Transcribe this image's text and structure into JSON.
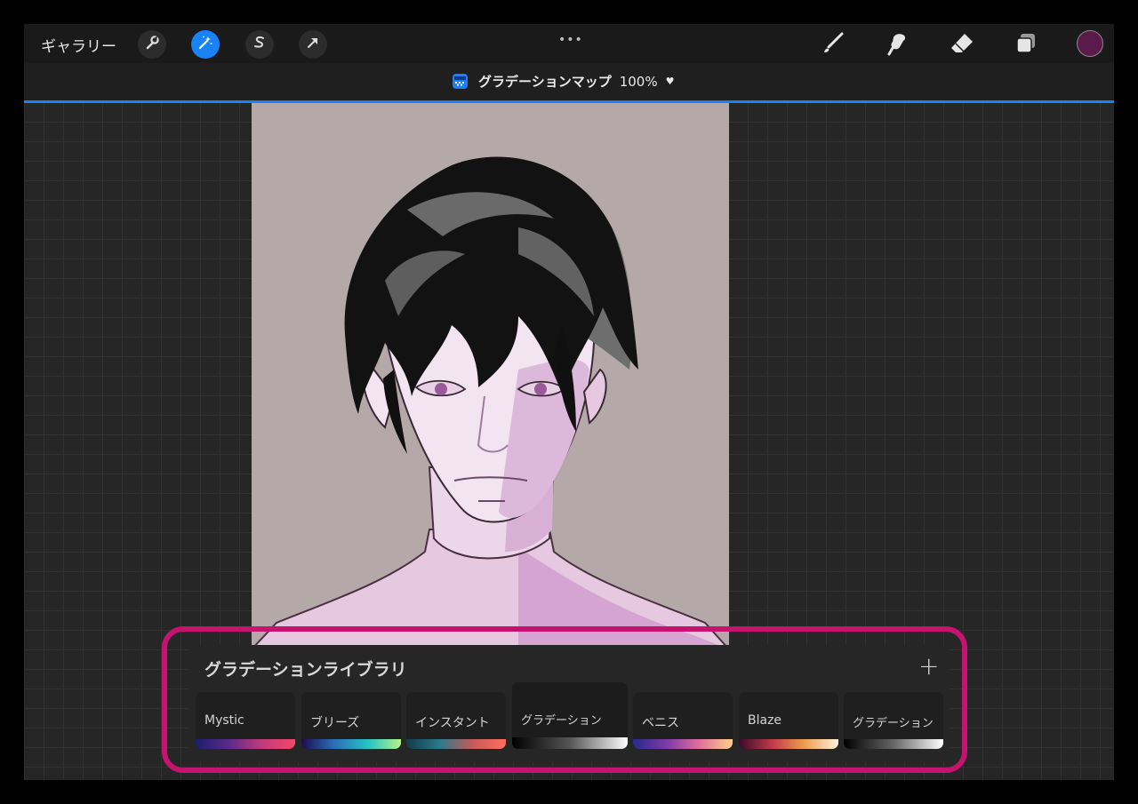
{
  "toolbar": {
    "gallery_label": "ギャラリー",
    "left_tools": [
      "wrench-icon",
      "magic-wand-icon",
      "selection-s-icon",
      "arrow-cursor-icon"
    ],
    "center_menu": "•••",
    "right_tools": [
      "brush-icon",
      "smudge-icon",
      "eraser-icon",
      "layers-icon"
    ],
    "current_color": "#5a1a4a"
  },
  "adjustment": {
    "name": "グラデーションマップ",
    "opacity": "100%",
    "caret": "♥",
    "accent": "#1a82f7"
  },
  "library": {
    "title": "グラデーションライブラリ",
    "add_label": "+",
    "highlight_color": "#c4146f",
    "selected_index": 3,
    "items": [
      {
        "label": "Mystic",
        "gradient": "linear-gradient(90deg,#1d1f6e,#5a2a8a,#c23a7a,#f24a6a)"
      },
      {
        "label": "ブリーズ",
        "gradient": "linear-gradient(90deg,#1b0d4f,#2d6fb7,#23c3c3,#b6f28a)"
      },
      {
        "label": "インスタント",
        "gradient": "linear-gradient(90deg,#123a4a,#2a7a8a,#c65a5a,#ff7060)"
      },
      {
        "label": "グラデーション",
        "gradient": "linear-gradient(90deg,#000000,#555555,#ffffff)"
      },
      {
        "label": "ベニス",
        "gradient": "linear-gradient(90deg,#2a2a8a,#7a3aa8,#e0709a,#ffd08a)"
      },
      {
        "label": "Blaze",
        "gradient": "linear-gradient(90deg,#3a0a2a,#c03a4a,#f0a050,#fff0e0)"
      },
      {
        "label": "グラデーション",
        "gradient": "linear-gradient(90deg,#000000,#666666,#ffffff)"
      }
    ]
  }
}
